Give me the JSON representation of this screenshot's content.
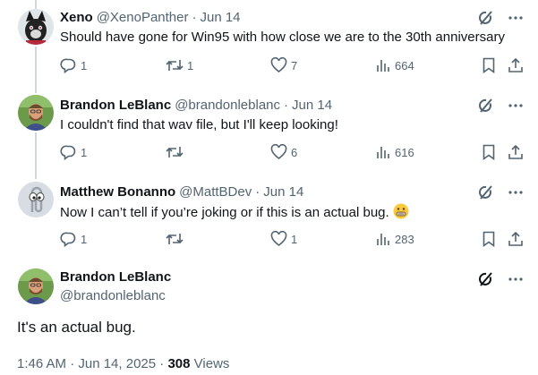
{
  "replies": [
    {
      "name": "Xeno",
      "handle": "@XenoPanther",
      "date": "Jun 14",
      "text": "Should have gone for Win95 with how close we are to the 30th anniversary",
      "replies": "1",
      "reposts": "1",
      "likes": "7",
      "views": "664"
    },
    {
      "name": "Brandon LeBlanc",
      "handle": "@brandonleblanc",
      "date": "Jun 14",
      "text": "I couldn't find that wav file, but I'll keep looking!",
      "replies": "1",
      "reposts": "",
      "likes": "6",
      "views": "616"
    },
    {
      "name": "Matthew Bonanno",
      "handle": "@MattBDev",
      "date": "Jun 14",
      "text": "Now I can’t tell if you’re joking or if this is an actual bug.",
      "replies": "1",
      "reposts": "",
      "likes": "1",
      "views": "283"
    }
  ],
  "main": {
    "name": "Brandon LeBlanc",
    "handle": "@brandonleblanc",
    "text": "It's an actual bug.",
    "timestamp": "1:46 AM · Jun 14, 2025",
    "separator": "·",
    "views_count": "308",
    "views_label": "Views"
  },
  "colors": {
    "text": "#0f1419",
    "secondary": "#536471",
    "thread_line": "#cfd9de"
  }
}
